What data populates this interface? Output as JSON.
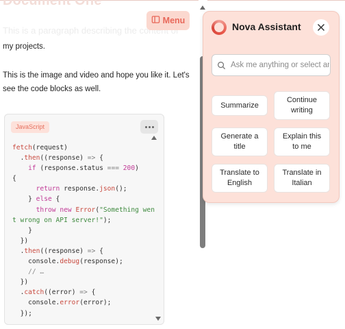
{
  "editor": {
    "doc_title": "Document One",
    "faded_line": "This is a paragraph describing the content of",
    "paragraphs": [
      "my projects.",
      "This is the image and video and hope you like it. Let's see the code blocks as well."
    ],
    "menu_label": "Menu",
    "code_block": {
      "language": "JavaScript"
    }
  },
  "assistant": {
    "title": "Nova Assistant",
    "search_placeholder": "Ask me anything or select an action",
    "actions": [
      "Summarize",
      "Continue writing",
      "Generate a title",
      "Explain this to me",
      "Translate to English",
      "Translate in Italian"
    ]
  },
  "colors": {
    "accent": "#e8685a",
    "panel_bg": "#fde1d9",
    "badge_bg": "#fde1da"
  },
  "icons": [
    "menu-icon",
    "more-icon",
    "assistant-logo-icon",
    "close-icon",
    "search-icon"
  ]
}
